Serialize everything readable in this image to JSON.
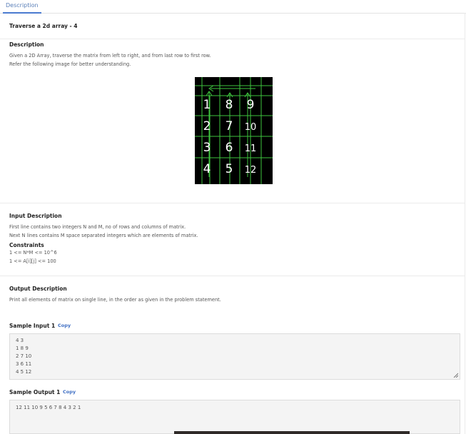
{
  "tab": {
    "label": "Description"
  },
  "problem": {
    "title": "Traverse a 2d array - 4"
  },
  "description": {
    "heading": "Description",
    "line1": "Given a 2D Array, traverse the matrix from left to right, and from last row to first row.",
    "line2": "Refer the following image for better understanding."
  },
  "figure": {
    "rows": [
      [
        "1",
        "8",
        "9"
      ],
      [
        "2",
        "7",
        "10"
      ],
      [
        "3",
        "6",
        "11"
      ],
      [
        "4",
        "5",
        "12"
      ]
    ],
    "ink_color": "#ffffff",
    "line_color": "#3ec43e"
  },
  "input": {
    "heading": "Input Description",
    "line1": "First line contains two integers N and M, no of rows and columns of matrix.",
    "line2": "Next N lines contains M space separated integers which are elements of matrix.",
    "constraints_heading": "Constraints",
    "c1": "1 <= N*M <= 10^6",
    "c2": "1 <= A[i][j] <= 100"
  },
  "output": {
    "heading": "Output Description",
    "line1": "Print all elements of matrix on single line, in the order as given in the problem statement."
  },
  "sample_input": {
    "label": "Sample Input 1",
    "copy_label": "Copy",
    "lines": [
      "4 3",
      "1 8 9",
      "2 7 10",
      "3 6 11",
      "4 5 12"
    ]
  },
  "sample_output": {
    "label": "Sample Output 1",
    "copy_label": "Copy",
    "lines": [
      "12 11 10 9 5 6 7 8 4 3 2 1"
    ]
  },
  "colors": {
    "accent": "#4a7bd0",
    "link": "#3f6fc4",
    "box_bg": "#f4f4f4"
  }
}
